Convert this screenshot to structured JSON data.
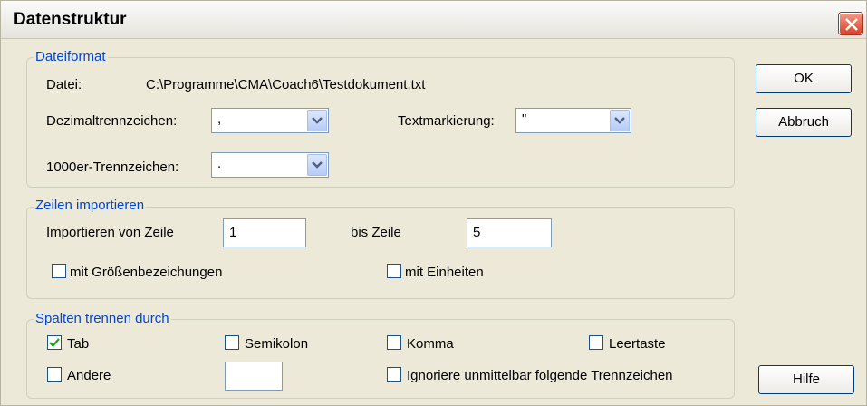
{
  "window": {
    "title": "Datenstruktur",
    "close_icon": "close-icon"
  },
  "dateiformat": {
    "legend": "Dateiformat",
    "datei_label": "Datei:",
    "datei_value": "C:\\Programme\\CMA\\Coach6\\Testdokument.txt",
    "dezimal_label": "Dezimaltrennzeichen:",
    "dezimal_value": ",",
    "text_label": "Textmarkierung:",
    "text_value": "\"",
    "tausend_label": "1000er-Trennzeichen:",
    "tausend_value": "."
  },
  "zeilen": {
    "legend": "Zeilen importieren",
    "von_label": "Importieren von Zeile",
    "von_value": "1",
    "bis_label": "bis Zeile",
    "bis_value": "5",
    "groessen_label": "mit Größenbezeichungen",
    "groessen_checked": false,
    "einheiten_label": "mit Einheiten",
    "einheiten_checked": false
  },
  "spalten": {
    "legend": "Spalten trennen durch",
    "tab_label": "Tab",
    "tab_checked": true,
    "semikolon_label": "Semikolon",
    "komma_label": "Komma",
    "leertaste_label": "Leertaste",
    "andere_label": "Andere",
    "andere_value": "",
    "ignoriere_label": "Ignoriere unmittelbar folgende Trennzeichen"
  },
  "buttons": {
    "ok": "OK",
    "abbruch": "Abbruch",
    "hilfe": "Hilfe"
  },
  "colors": {
    "legend": "#0046d5",
    "close": "#d9432a",
    "dialog_bg": "#ece9d8"
  }
}
